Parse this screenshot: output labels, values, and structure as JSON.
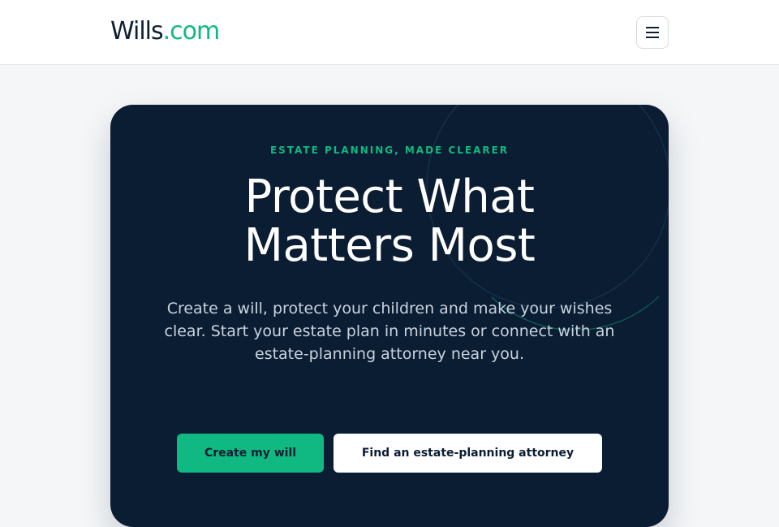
{
  "header": {
    "logo_main": "Wills",
    "logo_accent": ".com",
    "menu_icon": "hamburger-menu-icon"
  },
  "hero": {
    "eyebrow": "ESTATE PLANNING, MADE CLEARER",
    "headline_line1": "Protect What",
    "headline_line2": "Matters Most",
    "lede": "Create a will, protect your children and make your wishes clear. Start your estate plan in minutes or connect with an estate-planning attorney near you.",
    "primary_cta": "Create my will",
    "secondary_cta": "Find an estate-planning attorney"
  },
  "colors": {
    "accent": "#10b981",
    "navy": "#0b1d33",
    "page_background": "#f4f6f8",
    "card_white": "#ffffff"
  }
}
